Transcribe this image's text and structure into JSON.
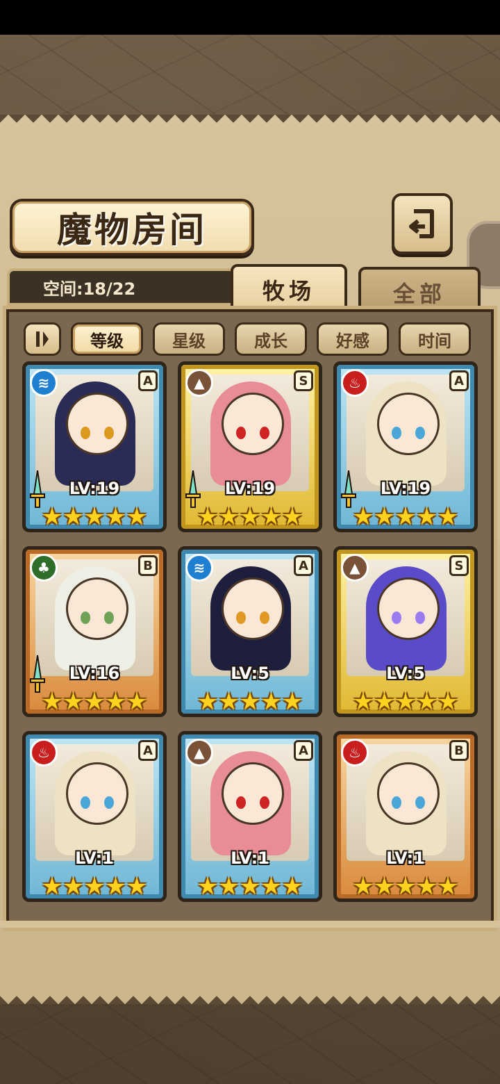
{
  "header": {
    "title": "魔物房间",
    "back_icon": "return-arrow-icon"
  },
  "space": {
    "label": "空间:18/22"
  },
  "tabs": [
    {
      "label": "牧场",
      "active": true
    },
    {
      "label": "全部",
      "active": false
    }
  ],
  "filters": {
    "sort_icon": "sort-toggle-icon",
    "options": [
      {
        "label": "等级",
        "active": true
      },
      {
        "label": "星级",
        "active": false
      },
      {
        "label": "成长",
        "active": false
      },
      {
        "label": "好感",
        "active": false
      },
      {
        "label": "时间",
        "active": false
      }
    ]
  },
  "monsters": [
    {
      "element": "water",
      "element_color": "#1f7fd1",
      "rank": "A",
      "frame": "blue",
      "level": "LV:19",
      "stars": 5,
      "weapon": true,
      "hair": "#2b2c55",
      "eye": "#d99a1e"
    },
    {
      "element": "earth",
      "element_color": "#7a5238",
      "rank": "S",
      "frame": "gold",
      "level": "LV:19",
      "stars": 5,
      "weapon": true,
      "hair": "#e88c98",
      "eye": "#d02424"
    },
    {
      "element": "fire",
      "element_color": "#c81e1e",
      "rank": "A",
      "frame": "blue",
      "level": "LV:19",
      "stars": 5,
      "weapon": true,
      "hair": "#ede3c4",
      "eye": "#4aa6d6"
    },
    {
      "element": "wood",
      "element_color": "#2f6d2a",
      "rank": "B",
      "frame": "bronze",
      "level": "LV:16",
      "stars": 5,
      "weapon": true,
      "hair": "#eef0e6",
      "eye": "#6fa257"
    },
    {
      "element": "water",
      "element_color": "#1f7fd1",
      "rank": "A",
      "frame": "blue",
      "level": "LV:5",
      "stars": 5,
      "weapon": false,
      "hair": "#1e1f3c",
      "eye": "#e09a24"
    },
    {
      "element": "earth",
      "element_color": "#7a5238",
      "rank": "S",
      "frame": "gold",
      "level": "LV:5",
      "stars": 5,
      "weapon": false,
      "hair": "#5a4cc8",
      "eye": "#9b7bf0"
    },
    {
      "element": "fire",
      "element_color": "#c81e1e",
      "rank": "A",
      "frame": "blue",
      "level": "LV:1",
      "stars": 5,
      "weapon": false,
      "hair": "#ede3c4",
      "eye": "#4aa6d6"
    },
    {
      "element": "earth",
      "element_color": "#7a5238",
      "rank": "A",
      "frame": "blue",
      "level": "LV:1",
      "stars": 5,
      "weapon": false,
      "hair": "#e88c98",
      "eye": "#d02424"
    },
    {
      "element": "fire",
      "element_color": "#c81e1e",
      "rank": "B",
      "frame": "bronze",
      "level": "LV:1",
      "stars": 5,
      "weapon": false,
      "hair": "#ede3c4",
      "eye": "#4aa6d6"
    }
  ]
}
